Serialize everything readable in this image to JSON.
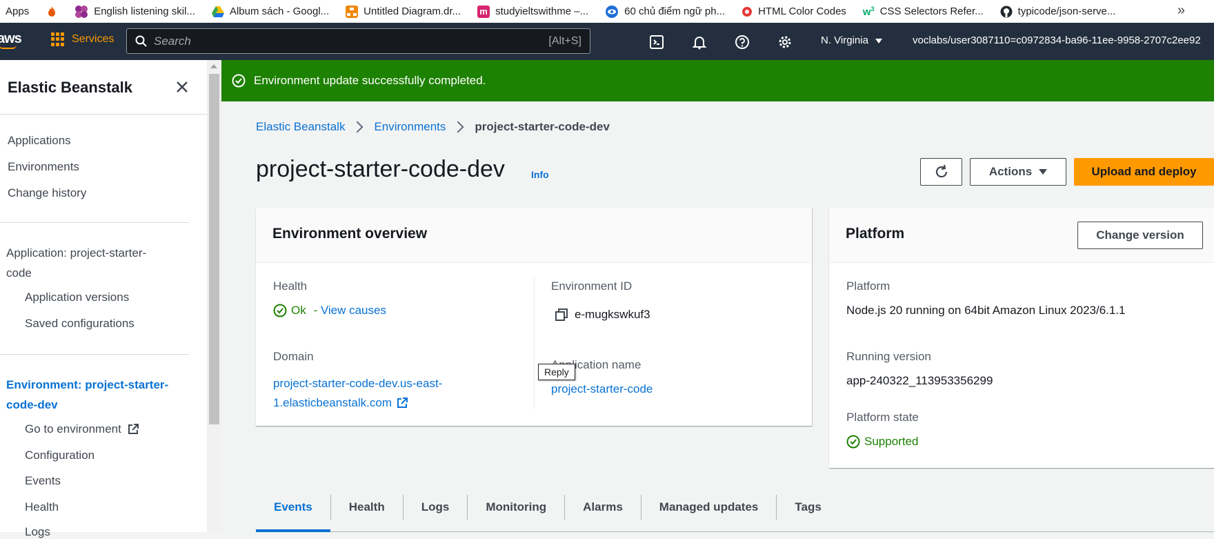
{
  "browser": {
    "bookmarks": [
      {
        "label": "Apps",
        "icon": "apps-grid-icon",
        "color": "#f28b0d"
      },
      {
        "label": "",
        "icon": "fire-icon",
        "color": "#e8590c"
      },
      {
        "label": "English listening skil...",
        "icon": "flower-icon",
        "color": "#8e2a8e"
      },
      {
        "label": "Album sách - Googl...",
        "icon": "google-drive-icon",
        "color": "#1a73e8"
      },
      {
        "label": "Untitled Diagram.dr...",
        "icon": "drawio-icon",
        "color": "#f08705"
      },
      {
        "label": "studyieltswithme –...",
        "icon": "m-logo-icon",
        "color": "#d6246e"
      },
      {
        "label": "60 chủ điểm ngữ ph...",
        "icon": "eye-logo-icon",
        "color": "#1d6ed8"
      },
      {
        "label": "HTML Color Codes",
        "icon": "color-wheel-icon",
        "color": "#e53935"
      },
      {
        "label": "CSS Selectors Refer...",
        "icon": "w3schools-icon",
        "color": "#04aa6d"
      },
      {
        "label": "typicode/json-serve...",
        "icon": "github-icon",
        "color": "#24292f"
      }
    ],
    "overflow": "»"
  },
  "topnav": {
    "logo": "aws",
    "services": "Services",
    "search_placeholder": "Search",
    "search_shortcut": "[Alt+S]",
    "region": "N. Virginia",
    "user": "voclabs/user3087110=c0972834-ba96-11ee-9958-2707c2ee92"
  },
  "sidebar": {
    "title": "Elastic Beanstalk",
    "top_items": [
      "Applications",
      "Environments",
      "Change history"
    ],
    "application_label": "Application: project-starter-code",
    "application_label_line1": "Application: project-starter-",
    "application_label_line2": "code",
    "application_items": [
      "Application versions",
      "Saved configurations"
    ],
    "environment_label_line1": "Environment: project-starter-",
    "environment_label_line2": "code-dev",
    "environment_items": [
      "Go to environment",
      "Configuration",
      "Events",
      "Health",
      "Logs"
    ]
  },
  "flash": {
    "message": "Environment update successfully completed."
  },
  "breadcrumb": [
    "Elastic Beanstalk",
    "Environments",
    "project-starter-code-dev"
  ],
  "page": {
    "title": "project-starter-code-dev",
    "info": "Info",
    "actions_label": "Actions",
    "upload_label": "Upload and deploy"
  },
  "overview": {
    "title": "Environment overview",
    "health_label": "Health",
    "health_value": "Ok",
    "health_sep": " - ",
    "health_link": "View causes",
    "domain_label": "Domain",
    "domain_line1": "project-starter-code-dev.us-east-",
    "domain_line2": "1.elasticbeanstalk.com",
    "env_id_label": "Environment ID",
    "env_id_value": "e-mugkswkuf3",
    "app_name_label": "Application name",
    "app_name_value": "project-starter-code"
  },
  "platform": {
    "title": "Platform",
    "change_version": "Change version",
    "platform_label": "Platform",
    "platform_value": "Node.js 20 running on 64bit Amazon Linux 2023/6.1.1",
    "running_label": "Running version",
    "running_value": "app-240322_113953356299",
    "state_label": "Platform state",
    "state_value": "Supported"
  },
  "tooltip": "Reply",
  "tabs": [
    "Events",
    "Health",
    "Logs",
    "Monitoring",
    "Alarms",
    "Managed updates",
    "Tags"
  ],
  "colors": {
    "success": "#1d8102",
    "link": "#0972d3",
    "primary": "#ff9900",
    "nav": "#232f3e"
  }
}
